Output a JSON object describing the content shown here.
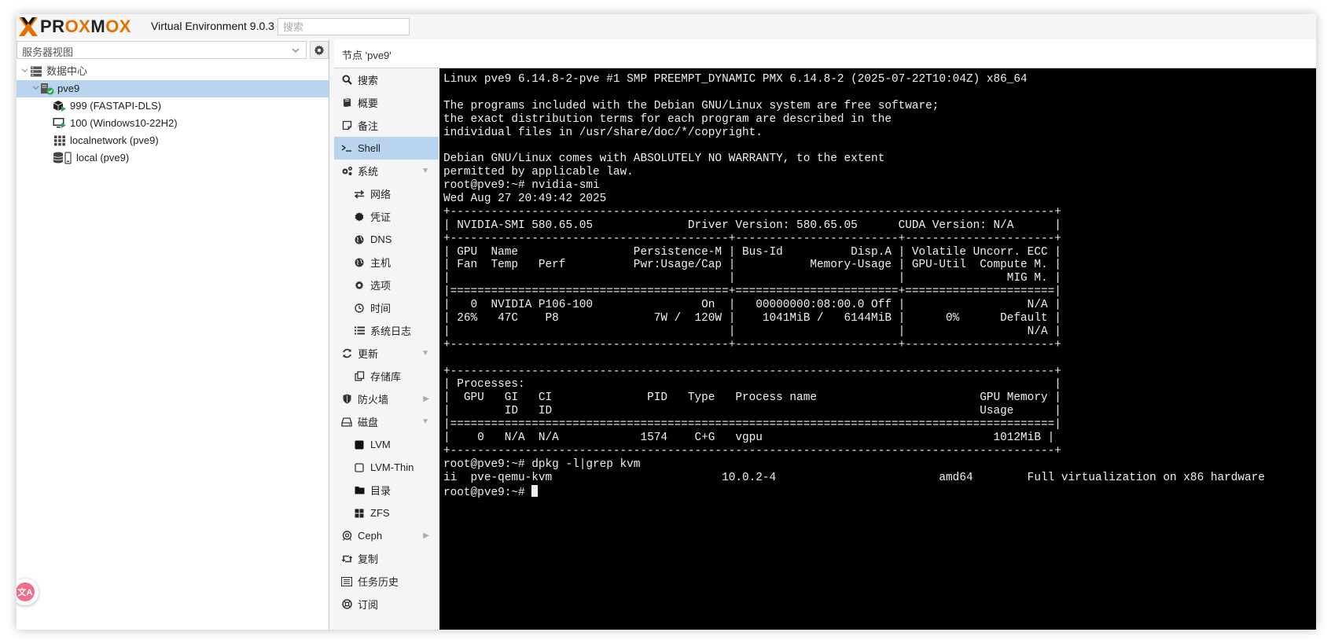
{
  "header": {
    "brand_left": "PR",
    "brand_ox1": "OX",
    "brand_m": "M",
    "brand_ox2": "OX",
    "version": "Virtual Environment 9.0.3",
    "search_placeholder": "搜索"
  },
  "left": {
    "view_select": "服务器视图",
    "tree": [
      {
        "label": "数据中心",
        "icon": "datacenter-icon"
      },
      {
        "label": "pve9",
        "icon": "node-online-icon",
        "selected": true
      },
      {
        "label": "999 (FASTAPI-DLS)",
        "icon": "container-icon"
      },
      {
        "label": "100 (Windows10-22H2)",
        "icon": "vm-running-icon"
      },
      {
        "label": "localnetwork (pve9)",
        "icon": "network-grid-icon"
      },
      {
        "label": "local (pve9)",
        "icon": "storage-icon"
      }
    ]
  },
  "content": {
    "title": "节点 'pve9'"
  },
  "nav": {
    "items": [
      {
        "label": "搜索",
        "icon": "search-icon"
      },
      {
        "label": "概要",
        "icon": "book-icon"
      },
      {
        "label": "备注",
        "icon": "notes-icon"
      },
      {
        "label": "Shell",
        "icon": "terminal-icon",
        "selected": true
      },
      {
        "label": "系统",
        "icon": "gears-icon",
        "expand": "down"
      },
      {
        "label": "网络",
        "icon": "exchange-icon",
        "sub": true
      },
      {
        "label": "凭证",
        "icon": "certificate-icon",
        "sub": true
      },
      {
        "label": "DNS",
        "icon": "globe-icon",
        "sub": true
      },
      {
        "label": "主机",
        "icon": "globe-icon",
        "sub": true
      },
      {
        "label": "选项",
        "icon": "gear-icon",
        "sub": true
      },
      {
        "label": "时间",
        "icon": "clock-icon",
        "sub": true
      },
      {
        "label": "系统日志",
        "icon": "list-icon",
        "sub": true
      },
      {
        "label": "更新",
        "icon": "refresh-icon",
        "expand": "down"
      },
      {
        "label": "存储库",
        "icon": "files-icon",
        "sub": true
      },
      {
        "label": "防火墙",
        "icon": "shield-icon",
        "expand": "right"
      },
      {
        "label": "磁盘",
        "icon": "hdd-icon",
        "expand": "down"
      },
      {
        "label": "LVM",
        "icon": "square-icon",
        "sub": true
      },
      {
        "label": "LVM-Thin",
        "icon": "square-outline-icon",
        "sub": true
      },
      {
        "label": "目录",
        "icon": "folder-icon",
        "sub": true
      },
      {
        "label": "ZFS",
        "icon": "th-large-icon",
        "sub": true
      },
      {
        "label": "Ceph",
        "icon": "ceph-icon",
        "expand": "right"
      },
      {
        "label": "复制",
        "icon": "retweet-icon"
      },
      {
        "label": "任务历史",
        "icon": "task-list-icon"
      },
      {
        "label": "订阅",
        "icon": "support-icon"
      }
    ]
  },
  "terminal": {
    "lines": [
      "Linux pve9 6.14.8-2-pve #1 SMP PREEMPT_DYNAMIC PMX 6.14.8-2 (2025-07-22T10:04Z) x86_64",
      "",
      "The programs included with the Debian GNU/Linux system are free software;",
      "the exact distribution terms for each program are described in the",
      "individual files in /usr/share/doc/*/copyright.",
      "",
      "Debian GNU/Linux comes with ABSOLUTELY NO WARRANTY, to the extent",
      "permitted by applicable law.",
      "root@pve9:~# nvidia-smi",
      "Wed Aug 27 20:49:42 2025",
      "+-----------------------------------------------------------------------------------------+",
      "| NVIDIA-SMI 580.65.05              Driver Version: 580.65.05      CUDA Version: N/A      |",
      "+-----------------------------------------+------------------------+----------------------+",
      "| GPU  Name                 Persistence-M | Bus-Id          Disp.A | Volatile Uncorr. ECC |",
      "| Fan  Temp   Perf          Pwr:Usage/Cap |           Memory-Usage | GPU-Util  Compute M. |",
      "|                                         |                        |               MIG M. |",
      "|=========================================+========================+======================|",
      "|   0  NVIDIA P106-100                On  |   00000000:08:00.0 Off |                  N/A |",
      "| 26%   47C    P8              7W /  120W |    1041MiB /   6144MiB |      0%      Default |",
      "|                                         |                        |                  N/A |",
      "+-----------------------------------------+------------------------+----------------------+",
      "",
      "+-----------------------------------------------------------------------------------------+",
      "| Processes:                                                                              |",
      "|  GPU   GI   CI              PID   Type   Process name                        GPU Memory |",
      "|        ID   ID                                                               Usage      |",
      "|=========================================================================================|",
      "|    0   N/A  N/A            1574    C+G   vgpu                                  1012MiB |",
      "+-----------------------------------------------------------------------------------------+",
      "root@pve9:~# dpkg -l|grep kvm",
      "ii  pve-qemu-kvm                         10.0.2-4                        amd64        Full virtualization on x86 hardware",
      "root@pve9:~# "
    ]
  },
  "translate_badge": "文A"
}
